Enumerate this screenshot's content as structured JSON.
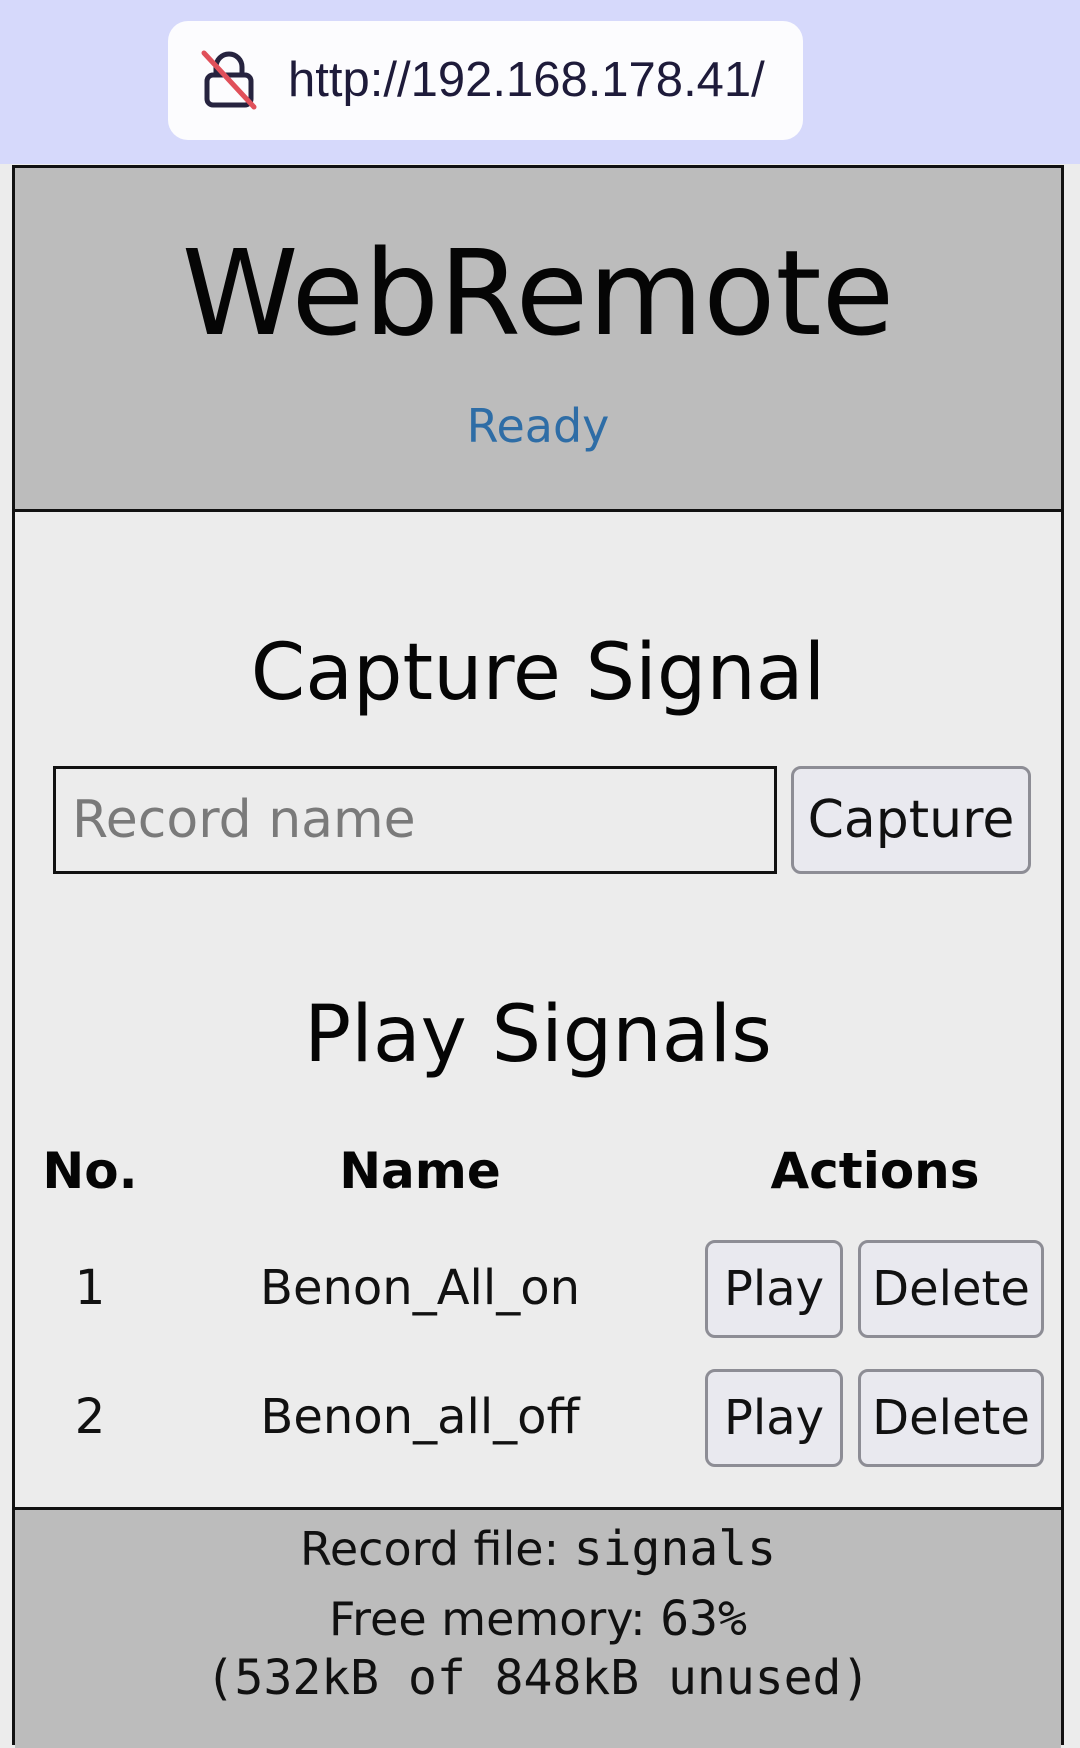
{
  "browser": {
    "url": "http://192.168.178.41/",
    "lock_icon": "insecure-lock-icon"
  },
  "header": {
    "title": "WebRemote",
    "status": "Ready",
    "status_color": "#2e6da6",
    "background": "#bcbcbc"
  },
  "capture": {
    "title": "Capture Signal",
    "input_placeholder": "Record name",
    "input_value": "",
    "button_label": "Capture"
  },
  "play": {
    "title": "Play Signals",
    "columns": [
      "No.",
      "Name",
      "Actions"
    ],
    "rows": [
      {
        "no": "1",
        "name": "Benon_All_on",
        "play_label": "Play",
        "delete_label": "Delete"
      },
      {
        "no": "2",
        "name": "Benon_all_off",
        "play_label": "Play",
        "delete_label": "Delete"
      }
    ]
  },
  "footer": {
    "record_file_label": "Record file:",
    "record_file_value": "signals",
    "free_memory_label": "Free memory:",
    "free_memory_value": "63%",
    "memory_detail": "(532kB of 848kB unused)"
  }
}
